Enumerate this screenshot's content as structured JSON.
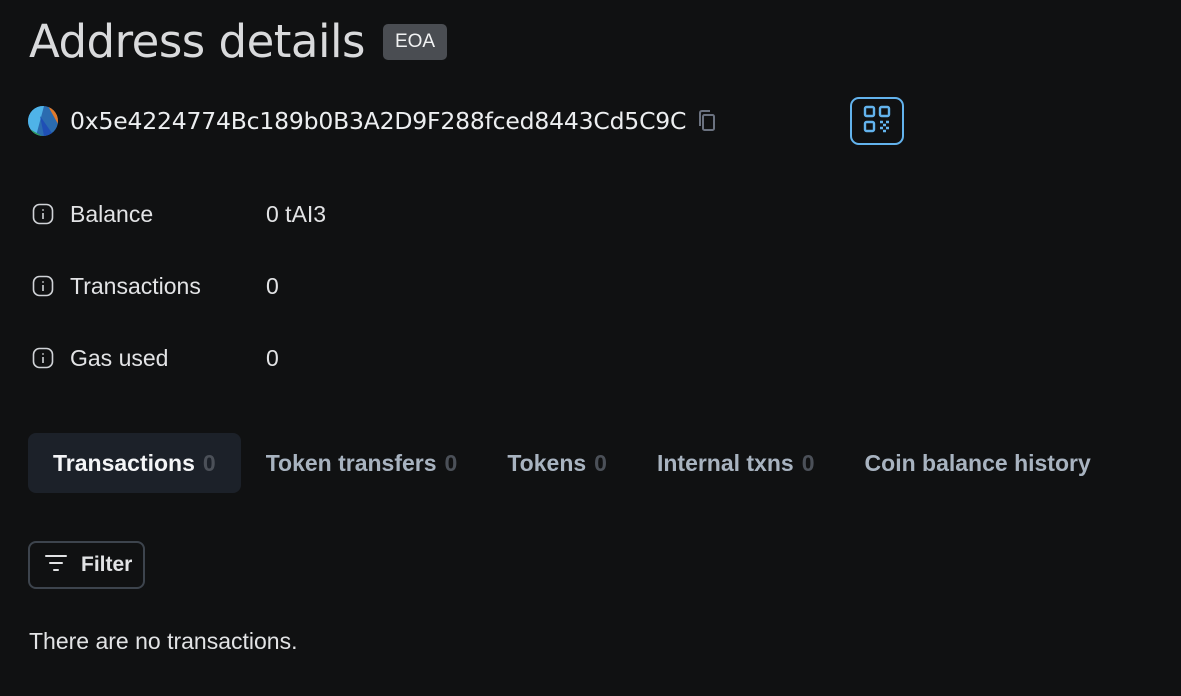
{
  "header": {
    "title": "Address details",
    "badge": "EOA"
  },
  "address": {
    "hash": "0x5e4224774Bc189b0B3A2D9F288fced8443Cd5C9C",
    "avatar_icon": "identicon-avatar",
    "copy_icon": "copy-icon",
    "qr_icon": "qr-code-icon"
  },
  "stats": [
    {
      "label": "Balance",
      "value": "0 tAI3",
      "icon": "info-icon"
    },
    {
      "label": "Transactions",
      "value": "0",
      "icon": "info-icon"
    },
    {
      "label": "Gas used",
      "value": "0",
      "icon": "info-icon"
    }
  ],
  "tabs": [
    {
      "label": "Transactions",
      "count": "0",
      "active": true
    },
    {
      "label": "Token transfers",
      "count": "0",
      "active": false
    },
    {
      "label": "Tokens",
      "count": "0",
      "active": false
    },
    {
      "label": "Internal txns",
      "count": "0",
      "active": false
    },
    {
      "label": "Coin balance history",
      "count": "",
      "active": false
    }
  ],
  "filter": {
    "label": "Filter",
    "icon": "filter-icon"
  },
  "empty_message": "There are no transactions.",
  "colors": {
    "background": "#101112",
    "accent": "#63b3ed",
    "active_tab_bg": "#1c2129",
    "badge_bg": "#4a4d52"
  }
}
